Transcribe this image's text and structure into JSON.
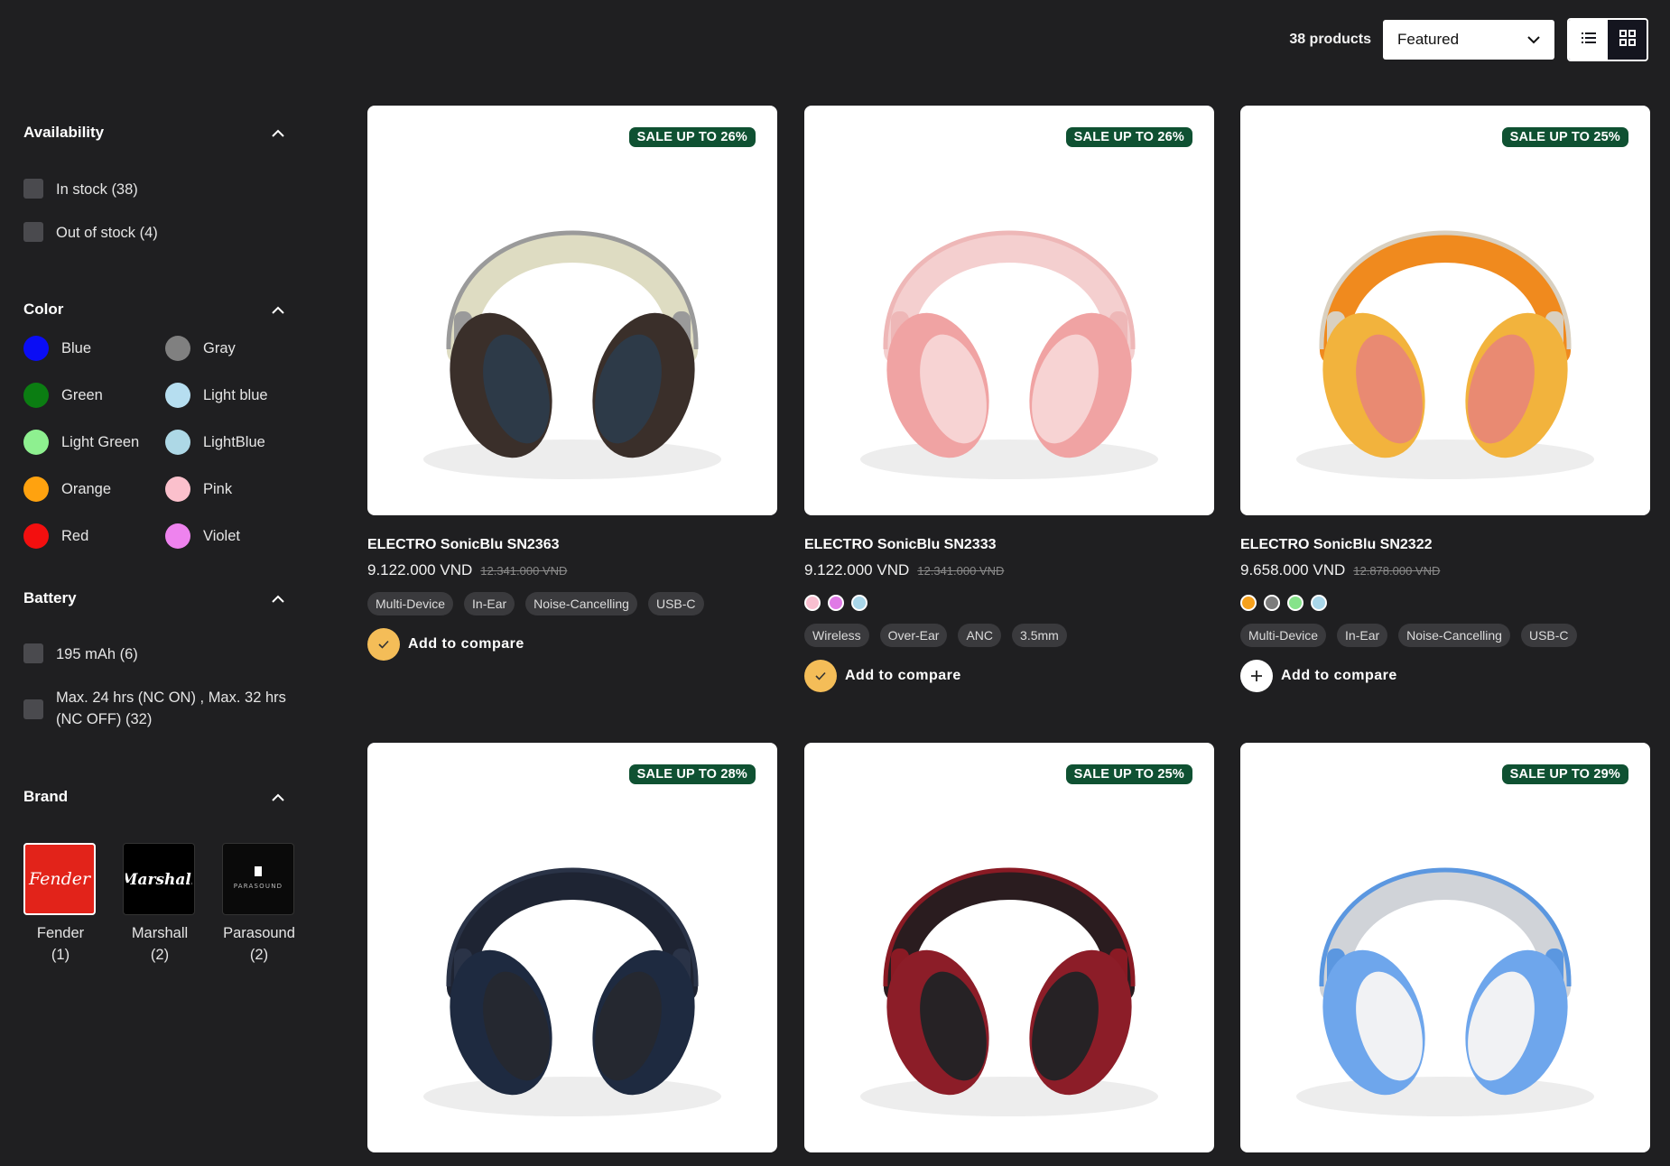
{
  "toolbar": {
    "product_count": "38 products",
    "sort_value": "Featured",
    "list_icon": "list-view-icon",
    "grid_icon": "grid-view-icon"
  },
  "filters": {
    "availability": {
      "title": "Availability",
      "options": [
        "In stock (38)",
        "Out of stock (4)"
      ]
    },
    "color": {
      "title": "Color",
      "options": [
        {
          "label": "Blue",
          "color": "#0a0df5"
        },
        {
          "label": "Gray",
          "color": "#808080"
        },
        {
          "label": "Green",
          "color": "#0b7d12"
        },
        {
          "label": "Light blue",
          "color": "#b6def0"
        },
        {
          "label": "Light Green",
          "color": "#8ef090"
        },
        {
          "label": "LightBlue",
          "color": "#add8e6"
        },
        {
          "label": "Orange",
          "color": "#ffa20f"
        },
        {
          "label": "Pink",
          "color": "#fbc0cc"
        },
        {
          "label": "Red",
          "color": "#f30f0f"
        },
        {
          "label": "Violet",
          "color": "#ee83ee"
        }
      ]
    },
    "battery": {
      "title": "Battery",
      "options": [
        "195 mAh (6)",
        "Max. 24 hrs (NC ON) , Max. 32 hrs (NC OFF) (32)"
      ]
    },
    "brand": {
      "title": "Brand",
      "options": [
        {
          "name": "Fender",
          "count": "(1)",
          "logo_text": "Fender"
        },
        {
          "name": "Marshall",
          "count": "(2)",
          "logo_text": "Marshall"
        },
        {
          "name": "Parasound",
          "count": "(2)",
          "logo_text": "PARASOUND"
        }
      ]
    }
  },
  "products": [
    {
      "badge": "SALE UP TO 26%",
      "name": "ELECTRO SonicBlu SN2363",
      "price": "9.122.000 VND",
      "old_price": "12.341.000 VND",
      "swatches": [],
      "tags": [
        "Multi-Device",
        "In-Ear",
        "Noise-Cancelling",
        "USB-C"
      ],
      "compare_label": "Add to compare",
      "compare_state": "selected",
      "colors": {
        "band": "#dedcc2",
        "frame": "#9a9a9a",
        "cup": "#3a2f2a",
        "pad": "#2d3a48"
      }
    },
    {
      "badge": "SALE UP TO 26%",
      "name": "ELECTRO SonicBlu SN2333",
      "price": "9.122.000 VND",
      "old_price": "12.341.000 VND",
      "swatches": [
        "#f9bfd0",
        "#e07ae6",
        "#a9d7ea"
      ],
      "tags": [
        "Wireless",
        "Over-Ear",
        "ANC",
        "3.5mm"
      ],
      "compare_label": "Add to compare",
      "compare_state": "selected",
      "colors": {
        "band": "#f4cfcf",
        "frame": "#eeb7b7",
        "cup": "#f0a3a3",
        "pad": "#f7d3d3"
      }
    },
    {
      "badge": "SALE UP TO 25%",
      "name": "ELECTRO SonicBlu SN2322",
      "price": "9.658.000 VND",
      "old_price": "12.878.000 VND",
      "swatches": [
        "#f6a11d",
        "#7c7c7c",
        "#86e38a",
        "#a9d7ea"
      ],
      "tags": [
        "Multi-Device",
        "In-Ear",
        "Noise-Cancelling",
        "USB-C"
      ],
      "compare_label": "Add to compare",
      "compare_state": "unselected",
      "colors": {
        "band": "#f08a1e",
        "frame": "#d9d0c0",
        "cup": "#f2b33d",
        "pad": "#e98a72"
      }
    },
    {
      "badge": "SALE UP TO 28%",
      "name": "",
      "colors": {
        "band": "#1e2433",
        "frame": "#2a3347",
        "cup": "#1e2a40",
        "pad": "#252830"
      }
    },
    {
      "badge": "SALE UP TO 25%",
      "name": "",
      "colors": {
        "band": "#2a1c1f",
        "frame": "#8a1a24",
        "cup": "#8c1d28",
        "pad": "#262225"
      }
    },
    {
      "badge": "SALE UP TO 29%",
      "name": "",
      "colors": {
        "band": "#d0d3d8",
        "frame": "#5b97e0",
        "cup": "#6ea6ec",
        "pad": "#f1f2f4"
      }
    }
  ]
}
